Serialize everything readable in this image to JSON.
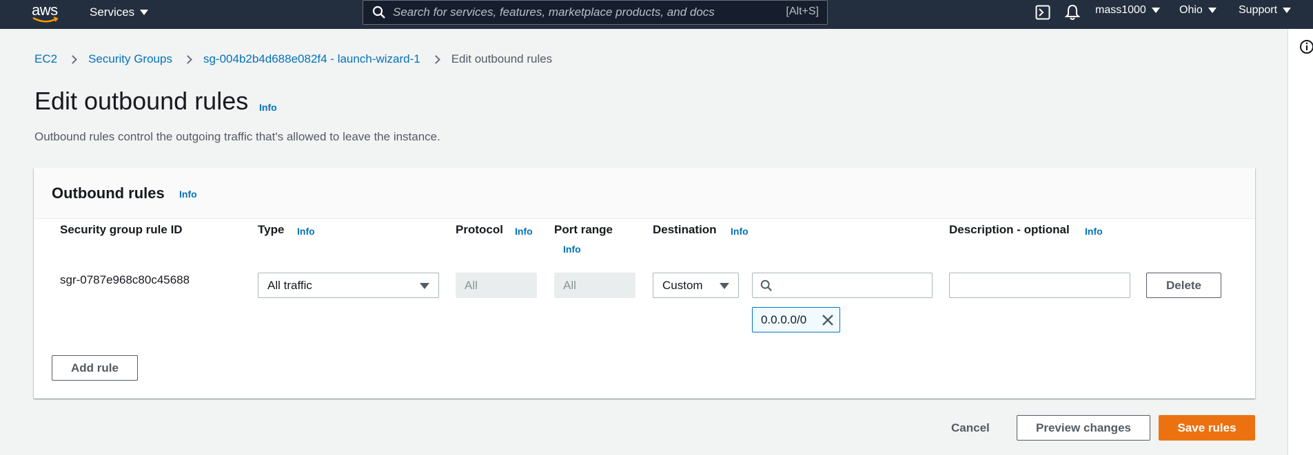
{
  "nav": {
    "logo": "aws",
    "services_label": "Services",
    "search_placeholder": "Search for services, features, marketplace products, and docs",
    "search_shortcut": "[Alt+S]",
    "account": "mass1000",
    "region": "Ohio",
    "support": "Support",
    "icons": [
      "cloudshell-icon",
      "bell-icon",
      "info-circle-icon"
    ]
  },
  "breadcrumb": {
    "items": [
      "EC2",
      "Security Groups",
      "sg-004b2b4d688e082f4 - launch-wizard-1"
    ],
    "current": "Edit outbound rules"
  },
  "page": {
    "title": "Edit outbound rules",
    "title_info": "Info",
    "description": "Outbound rules control the outgoing traffic that's allowed to leave the instance."
  },
  "panel": {
    "title": "Outbound rules",
    "title_info": "Info",
    "columns": {
      "rule_id": "Security group rule ID",
      "type": "Type",
      "protocol": "Protocol",
      "port_range": "Port range",
      "destination": "Destination",
      "description": "Description - optional"
    },
    "info_label": "Info",
    "rules": [
      {
        "rule_id": "sgr-0787e968c80c45688",
        "type": "All traffic",
        "protocol": "All",
        "port_range": "All",
        "destination_type": "Custom",
        "destination_search": "",
        "destination_token": "0.0.0.0/0",
        "description": "",
        "delete_label": "Delete"
      }
    ],
    "add_rule_label": "Add rule"
  },
  "footer": {
    "cancel_label": "Cancel",
    "preview_label": "Preview changes",
    "save_label": "Save rules"
  },
  "colors": {
    "nav_bg": "#232f3e",
    "link": "#0073bb",
    "primary": "#ec7211"
  }
}
